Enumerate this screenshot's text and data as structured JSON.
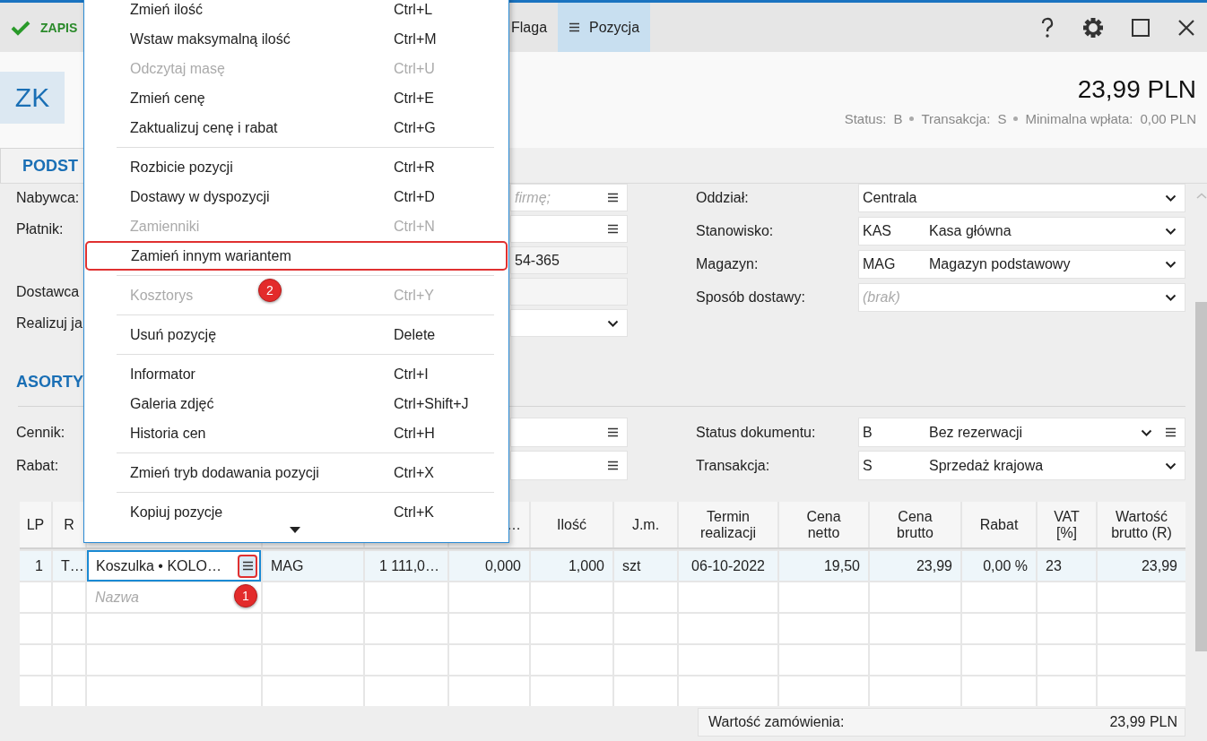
{
  "toolbar": {
    "save": {
      "label": "ZAPIS"
    },
    "buttons": [
      {
        "kind": "plain",
        "label": "Flaga",
        "selected": false
      },
      {
        "kind": "menu",
        "label": "Pozycja",
        "selected": true
      }
    ]
  },
  "header": {
    "badge": "ZK",
    "total": "23,99 PLN",
    "status": [
      {
        "label": "Status:",
        "value": "B"
      },
      {
        "label": "Transakcja:",
        "value": "S"
      },
      {
        "label": "Minimalna wpłata:",
        "value": "0,00 PLN"
      }
    ]
  },
  "tabs": [
    {
      "label": "PODST",
      "selected": true
    }
  ],
  "general_form": {
    "left": [
      {
        "label": "Nabywca:",
        "field": {
          "kind": "lookup",
          "placeholder": "firmę;"
        }
      },
      {
        "label": "Płatnik:",
        "field": {
          "kind": "lookup"
        }
      },
      {
        "field": {
          "kind": "readonly",
          "value": "54-365"
        }
      },
      {
        "label": "Dostawca",
        "field": {
          "kind": "readonly"
        }
      },
      {
        "label": "Realizuj ja",
        "field": {
          "kind": "dropdown"
        }
      }
    ],
    "right": [
      {
        "label": "Oddział:",
        "field": {
          "kind": "dropdown",
          "value": "Centrala"
        }
      },
      {
        "label": "Stanowisko:",
        "field": {
          "kind": "dropdown",
          "code": "KAS",
          "value": "Kasa główna"
        }
      },
      {
        "label": "Magazyn:",
        "field": {
          "kind": "dropdown",
          "code": "MAG",
          "value": "Magazyn podstawowy"
        }
      },
      {
        "label": "Sposób dostawy:",
        "field": {
          "kind": "dropdown",
          "placeholder": "(brak)"
        }
      }
    ]
  },
  "items_section": {
    "heading": "ASORTY",
    "left": [
      {
        "label": "Cennik:",
        "field": {
          "kind": "lookup"
        }
      },
      {
        "label": "Rabat:",
        "field": {
          "kind": "lookup"
        }
      }
    ],
    "right": [
      {
        "label": "Status dokumentu:",
        "field": {
          "kind": "dropdown_lookup",
          "code": "B",
          "value": "Bez rezerwacji"
        }
      },
      {
        "label": "Transakcja:",
        "field": {
          "kind": "dropdown",
          "code": "S",
          "value": "Sprzedaż krajowa"
        }
      }
    ]
  },
  "table": {
    "columns": [
      {
        "label": "LP"
      },
      {
        "label": "R"
      },
      {},
      {},
      {},
      {
        "label": "…"
      },
      {
        "label": "Ilość"
      },
      {
        "label": "J.m."
      },
      {
        "label": "Termin\nrealizacji"
      },
      {
        "label": "Cena\nnetto"
      },
      {
        "label": "Cena\nbrutto"
      },
      {
        "label": "Rabat"
      },
      {
        "label": "VAT\n[%]"
      },
      {
        "label": "Wartość\nbrutto (R)"
      }
    ],
    "rows": [
      {
        "kind": "item",
        "selected": true,
        "highlighted": true,
        "cells": [
          "1",
          "T…",
          "Koszulka • KOLO…",
          "MAG",
          "1 111,0…",
          "0,000",
          "1,000",
          "szt",
          "06-10-2022",
          "19,50",
          "23,99",
          "0,00 %",
          "23",
          "23,99"
        ]
      },
      {
        "kind": "new",
        "selected": false,
        "placeholder": "Nazwa"
      },
      {
        "kind": "blank",
        "selected": false
      },
      {
        "kind": "blank",
        "selected": false
      },
      {
        "kind": "blank",
        "selected": false
      }
    ]
  },
  "callouts": [
    {
      "number": "1"
    },
    {
      "number": "2"
    }
  ],
  "footer": {
    "label": "Wartość zamówienia:",
    "value": "23,99 PLN"
  },
  "menu": {
    "items": [
      {
        "kind": "item",
        "label": "Zmień ilość",
        "shortcut": "Ctrl+L",
        "disabled": false,
        "highlighted": false
      },
      {
        "kind": "item",
        "label": "Wstaw maksymalną ilość",
        "shortcut": "Ctrl+M",
        "disabled": false,
        "highlighted": false
      },
      {
        "kind": "item",
        "label": "Odczytaj masę",
        "shortcut": "Ctrl+U",
        "disabled": true,
        "highlighted": false
      },
      {
        "kind": "item",
        "label": "Zmień cenę",
        "shortcut": "Ctrl+E",
        "disabled": false,
        "highlighted": false
      },
      {
        "kind": "item",
        "label": "Zaktualizuj cenę i rabat",
        "shortcut": "Ctrl+G",
        "disabled": false,
        "highlighted": false
      },
      {
        "kind": "separator"
      },
      {
        "kind": "item",
        "label": "Rozbicie pozycji",
        "shortcut": "Ctrl+R",
        "disabled": false,
        "highlighted": false
      },
      {
        "kind": "item",
        "label": "Dostawy w dyspozycji",
        "shortcut": "Ctrl+D",
        "disabled": false,
        "highlighted": false
      },
      {
        "kind": "item",
        "label": "Zamienniki",
        "shortcut": "Ctrl+N",
        "disabled": true,
        "highlighted": false
      },
      {
        "kind": "item",
        "label": "Zamień innym wariantem",
        "disabled": false,
        "highlighted": true
      },
      {
        "kind": "separator"
      },
      {
        "kind": "item",
        "label": "Kosztorys",
        "shortcut": "Ctrl+Y",
        "disabled": true,
        "highlighted": false
      },
      {
        "kind": "separator"
      },
      {
        "kind": "item",
        "label": "Usuń pozycję",
        "shortcut": "Delete",
        "disabled": false,
        "highlighted": false
      },
      {
        "kind": "separator"
      },
      {
        "kind": "item",
        "label": "Informator",
        "shortcut": "Ctrl+I",
        "disabled": false,
        "highlighted": false
      },
      {
        "kind": "item",
        "label": "Galeria zdjęć",
        "shortcut": "Ctrl+Shift+J",
        "disabled": false,
        "highlighted": false
      },
      {
        "kind": "item",
        "label": "Historia cen",
        "shortcut": "Ctrl+H",
        "disabled": false,
        "highlighted": false
      },
      {
        "kind": "separator"
      },
      {
        "kind": "item",
        "label": "Zmień tryb dodawania pozycji",
        "shortcut": "Ctrl+X",
        "disabled": false,
        "highlighted": false
      },
      {
        "kind": "separator"
      },
      {
        "kind": "item",
        "label": "Kopiuj pozycje",
        "shortcut": "Ctrl+K",
        "disabled": false,
        "highlighted": false
      },
      {
        "kind": "more"
      }
    ]
  }
}
